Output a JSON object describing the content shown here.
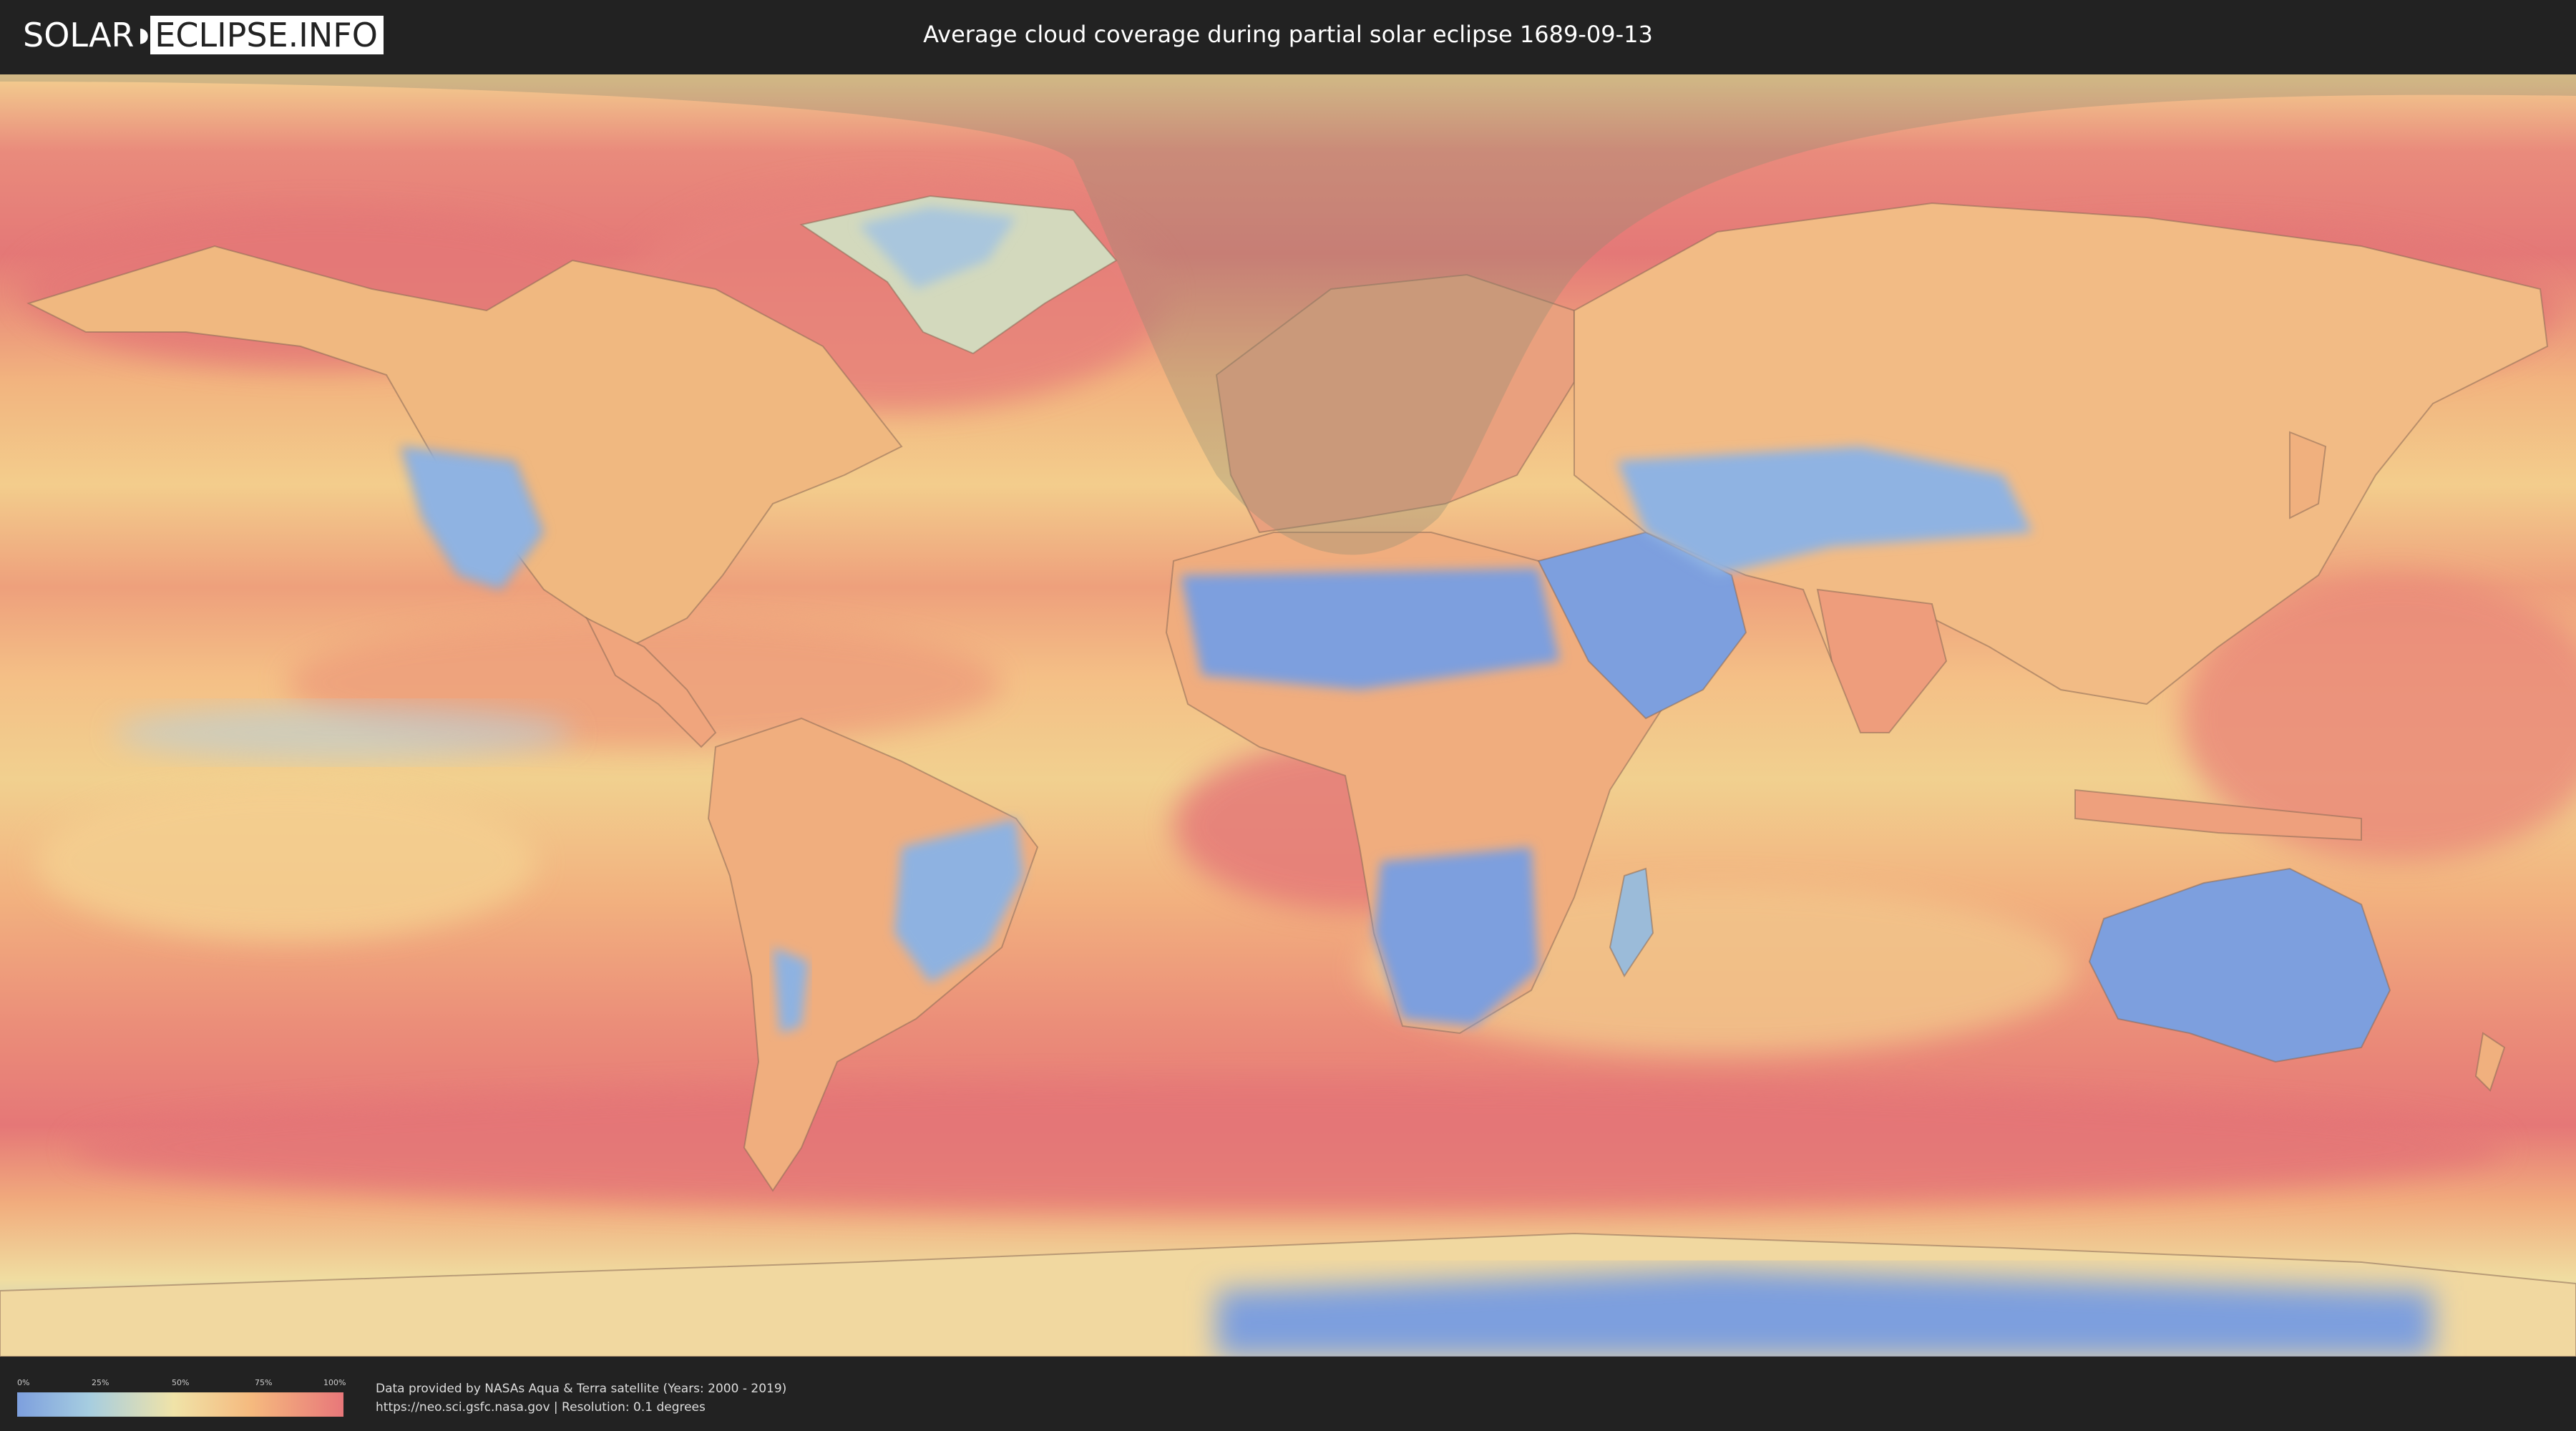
{
  "header": {
    "logo_left": "SOLAR",
    "logo_right": "ECLIPSE.INFO",
    "title": "Average cloud coverage during partial solar eclipse 1689-09-13"
  },
  "legend": {
    "labels": [
      "0%",
      "25%",
      "50%",
      "75%",
      "100%"
    ],
    "colors": [
      "#7d9fde",
      "#a6cde0",
      "#f0e3a8",
      "#f5b97e",
      "#e8777a"
    ]
  },
  "footer": {
    "line1": "Data provided by NASAs Aqua & Terra satellite (Years: 2000 - 2019)",
    "line2": "https://neo.sci.gsfc.nasa.gov | Resolution: 0.1 degrees"
  },
  "map": {
    "palette": {
      "ocean_cloudy": "#e8777a",
      "ocean_mid": "#f5b97e",
      "ocean_light": "#f0e3a8",
      "clear": "#7d9fde",
      "clear_light": "#a6cde0",
      "eclipse_shadow": "#8c8c73"
    }
  }
}
